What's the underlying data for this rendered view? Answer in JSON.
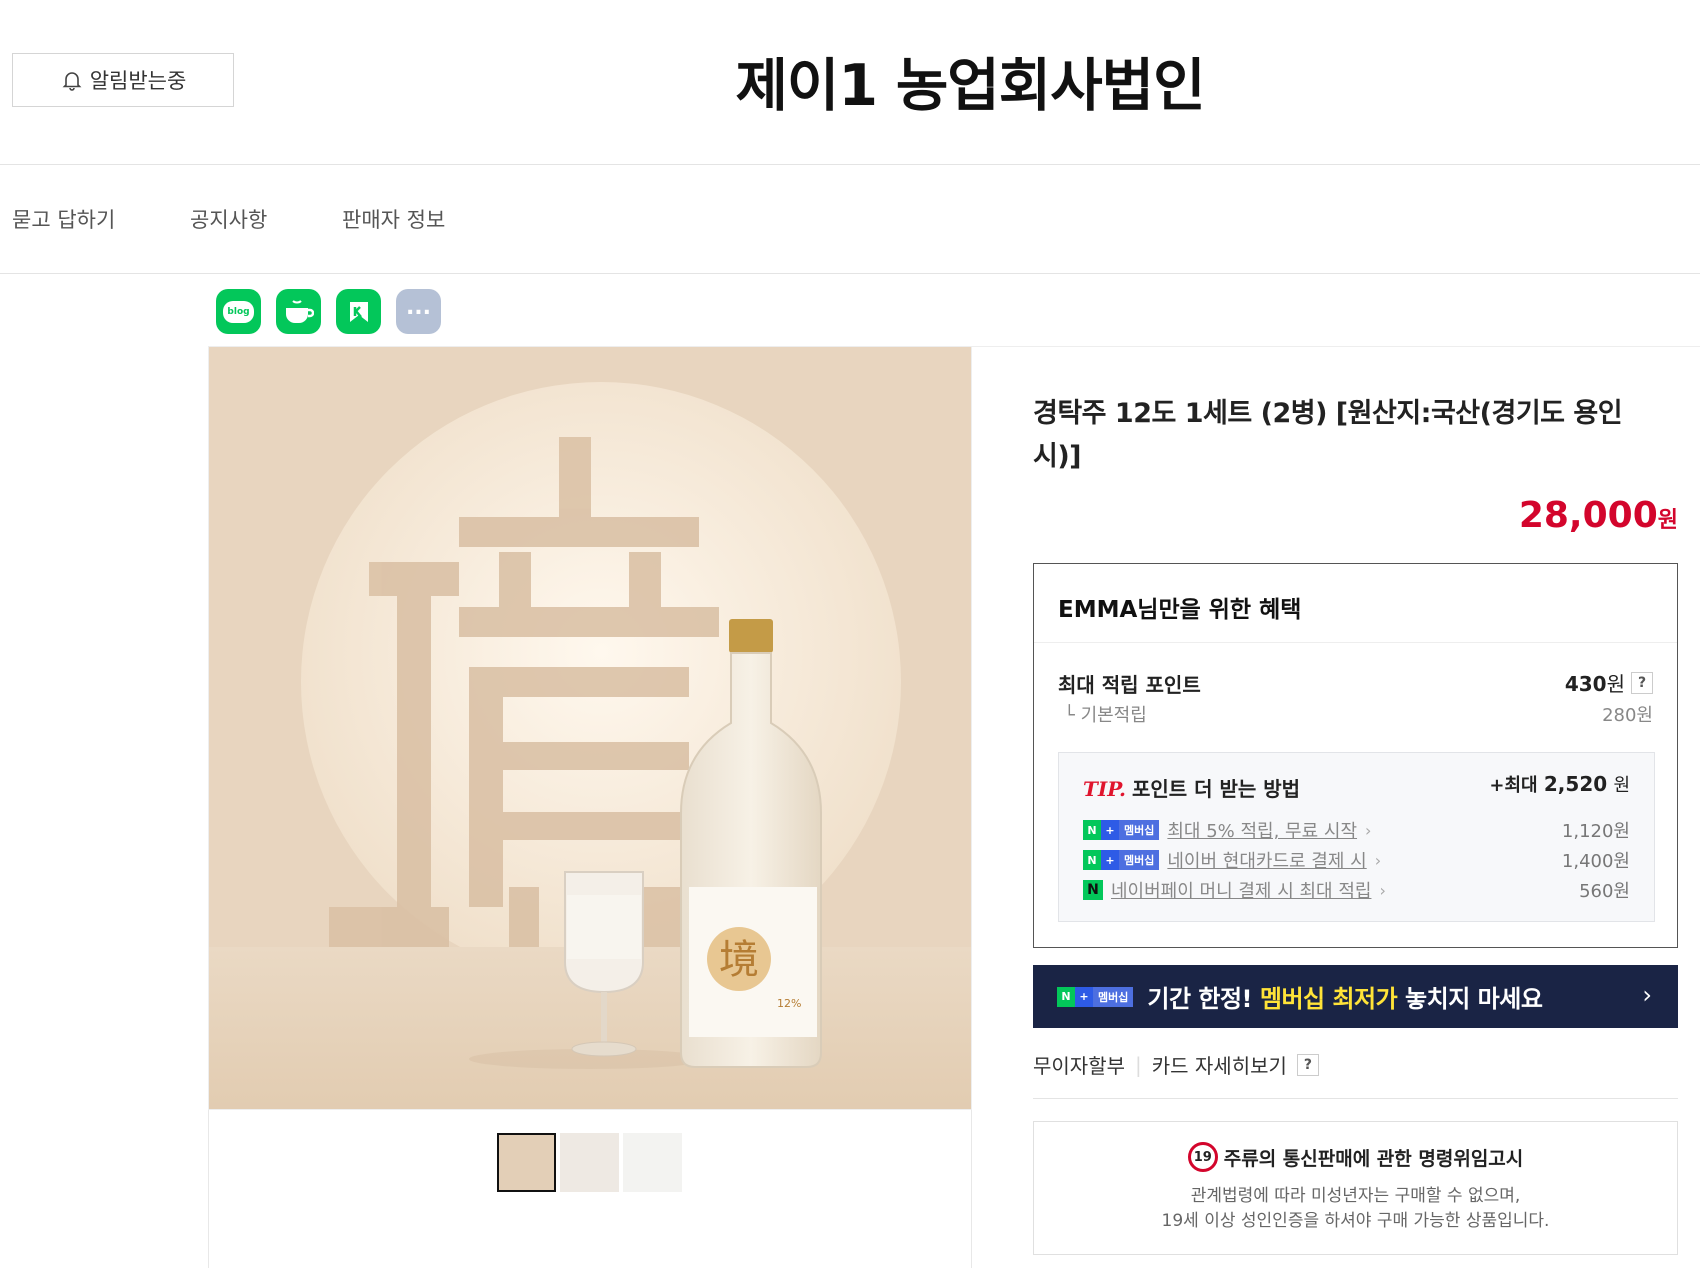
{
  "header": {
    "notify_label": "알림받는중",
    "store_name": "제이1 농업회사법인"
  },
  "tabs": [
    {
      "label": "묻고 답하기"
    },
    {
      "label": "공지사항"
    },
    {
      "label": "판매자 정보"
    }
  ],
  "share": {
    "icons": [
      "blog-icon",
      "cafe-icon",
      "keep-icon",
      "more-icon"
    ],
    "blog_text": "blog",
    "more_text": "..."
  },
  "product": {
    "title": "경탁주 12도 1세트 (2병) [원산지:국산(경기도 용인시)]",
    "price": "28,000",
    "currency": "원",
    "label_char": "境",
    "label_abv": "12%"
  },
  "benefit": {
    "heading": "EMMA님만을 위한 혜택",
    "max_points_label": "최대 적립 포인트",
    "max_points_value": "430",
    "max_points_unit": "원",
    "help": "?",
    "base_label": "기본적립",
    "base_value": "280원",
    "tip": {
      "tip_word": "TIP.",
      "label": "포인트 더 받는 방법",
      "max_prefix": "+최대",
      "max_value": "2,520",
      "max_unit": "원",
      "rows": [
        {
          "badge": "멤버십",
          "text": "최대 5% 적립, 무료 시작",
          "value": "1,120원"
        },
        {
          "badge": "멤버십",
          "text": "네이버 현대카드로 결제 시",
          "value": "1,400원"
        },
        {
          "badge": "",
          "text": "네이버페이 머니 결제 시 최대 적립",
          "value": "560원"
        }
      ]
    }
  },
  "banner": {
    "badge": "멤버십",
    "text_pre": "기간 한정! ",
    "text_hl": "멤버십 최저가",
    "text_post": " 놓치지 마세요",
    "arrow": "›"
  },
  "install": {
    "label": "무이자할부",
    "sep": "|",
    "card_label": "카드 자세히보기",
    "help": "?"
  },
  "adult_notice": {
    "badge": "19",
    "title": "주류의 통신판매에 관한 명령위임고시",
    "line1": "관계법령에 따라 미성년자는 구매할 수 없으며,",
    "line2": "19세 이상 성인인증을 하셔야 구매 가능한 상품입니다."
  },
  "colors": {
    "price": "#d3052c",
    "naver_green": "#03c75a",
    "banner_bg": "#1a2445",
    "banner_highlight": "#ffe338"
  }
}
